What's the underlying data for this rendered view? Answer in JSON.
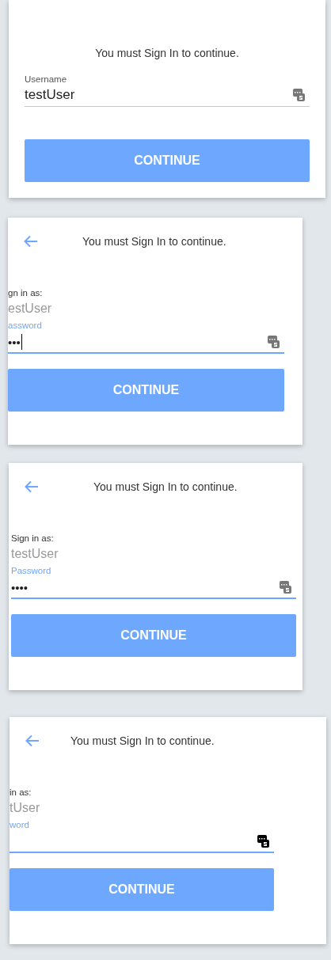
{
  "screens": [
    {
      "kind": "username",
      "title": "You must Sign In to continue.",
      "field_label": "Username",
      "field_value": "testUser",
      "button": "CONTINUE"
    },
    {
      "kind": "password",
      "title": "You must Sign In to continue.",
      "signin_label": "gn in as:",
      "user": "estUser",
      "field_label": "assword",
      "field_value": "•••",
      "cursor": true,
      "button": "CONTINUE"
    },
    {
      "kind": "password",
      "title": "You must Sign In to continue.",
      "signin_label": "Sign in as:",
      "user": "testUser",
      "field_label": "Password",
      "field_value": "••••",
      "cursor": false,
      "button": "CONTINUE"
    },
    {
      "kind": "password",
      "title": "You must Sign In to continue.",
      "signin_label": "in as:",
      "user": "tUser",
      "field_label": "word",
      "cursor": false,
      "button": "CONTINUE"
    }
  ]
}
